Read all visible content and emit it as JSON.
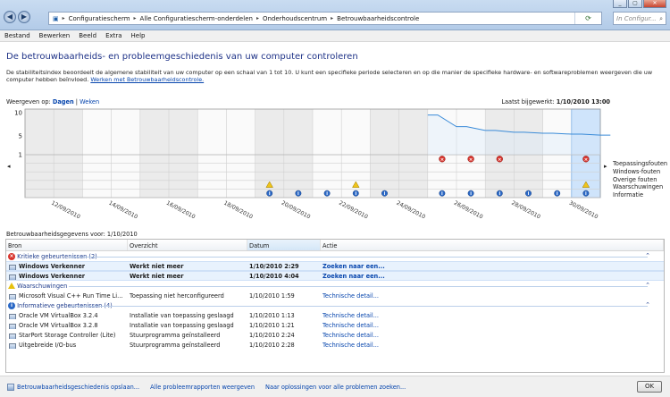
{
  "window": {
    "minimize": "_",
    "maximize": "▢",
    "close": "✕"
  },
  "address": {
    "crumbs": [
      "Configuratiescherm",
      "Alle Configuratiescherm-onderdelen",
      "Onderhoudscentrum",
      "Betrouwbaarheidscontrole"
    ],
    "search_placeholder": "In Configur..."
  },
  "menu": [
    "Bestand",
    "Bewerken",
    "Beeld",
    "Extra",
    "Help"
  ],
  "page": {
    "title": "De betrouwbaarheids- en probleemgeschiedenis van uw computer controleren",
    "intro": "De stabiliteitsindex beoordeelt de algemene stabiliteit van uw computer op een schaal van 1 tot 10. U kunt een specifieke periode selecteren en op die manier de specifieke hardware- en softwareproblemen weergeven die uw computer hebben beïnvloed.",
    "intro_link": "Werken met Betrouwbaarheidscontrole.",
    "view_by_label": "Weergeven op:",
    "view_days": "Dagen",
    "view_weeks": "Weken",
    "updated_label": "Laatst bijgewerkt:",
    "updated_value": "1/10/2010 13:00"
  },
  "chart_data": {
    "type": "line",
    "ylim": [
      1,
      10
    ],
    "y_ticks": [
      "10",
      "5",
      "1"
    ],
    "x_labels": [
      "12/09/2010",
      "14/09/2010",
      "16/09/2010",
      "18/09/2010",
      "20/09/2010",
      "22/09/2010",
      "24/09/2010",
      "26/09/2010",
      "28/09/2010",
      "30/09/2010"
    ],
    "days": 20,
    "stability_series": {
      "start_day": 14,
      "values": [
        9.5,
        7.0,
        6.2,
        5.8,
        5.6,
        5.4,
        5.2
      ]
    },
    "rows": [
      "Toepassingsfouten",
      "Windows-fouten",
      "Overige fouten",
      "Waarschuwingen",
      "Informatie"
    ],
    "events": {
      "app_errors": [
        14,
        15,
        16,
        19
      ],
      "warnings": [
        8,
        11,
        19
      ],
      "info": [
        8,
        9,
        10,
        11,
        12,
        14,
        15,
        16,
        17,
        18,
        19
      ]
    },
    "selected_day": 19
  },
  "details": {
    "header": "Betrouwbaarheidsgegevens voor: 1/10/2010",
    "columns": [
      "Bron",
      "Overzicht",
      "Datum",
      "Actie"
    ],
    "groups": {
      "critical": "Kritieke gebeurtenissen (2)",
      "warnings": "Waarschuwingen",
      "info": "Informatieve gebeurtenissen (4)"
    },
    "critical_rows": [
      {
        "source": "Windows Verkenner",
        "summary": "Werkt niet meer",
        "date": "1/10/2010 2:29",
        "action": "Zoeken naar een..."
      },
      {
        "source": "Windows Verkenner",
        "summary": "Werkt niet meer",
        "date": "1/10/2010 4:04",
        "action": "Zoeken naar een..."
      }
    ],
    "warning_rows": [
      {
        "source": "Microsoft Visual C++ Run Time Li...",
        "summary": "Toepassing niet herconfigureerd",
        "date": "1/10/2010 1:59",
        "action": "Technische detail..."
      }
    ],
    "info_rows": [
      {
        "source": "Oracle VM VirtualBox 3.2.4",
        "summary": "Installatie van toepassing geslaagd",
        "date": "1/10/2010 1:13",
        "action": "Technische detail..."
      },
      {
        "source": "Oracle VM VirtualBox 3.2.8",
        "summary": "Installatie van toepassing geslaagd",
        "date": "1/10/2010 1:21",
        "action": "Technische detail..."
      },
      {
        "source": "StarPort Storage Controller (Lite)",
        "summary": "Stuurprogramma geïnstalleerd",
        "date": "1/10/2010 2:24",
        "action": "Technische detail..."
      },
      {
        "source": "Uitgebreide I/O-bus",
        "summary": "Stuurprogramma geïnstalleerd",
        "date": "1/10/2010 2:28",
        "action": "Technische detail..."
      }
    ]
  },
  "footer": {
    "save": "Betrouwbaarheidsgeschiedenis opslaan...",
    "all_reports": "Alle probleemrapporten weergeven",
    "solutions": "Naar oplossingen voor alle problemen zoeken...",
    "ok": "OK"
  }
}
